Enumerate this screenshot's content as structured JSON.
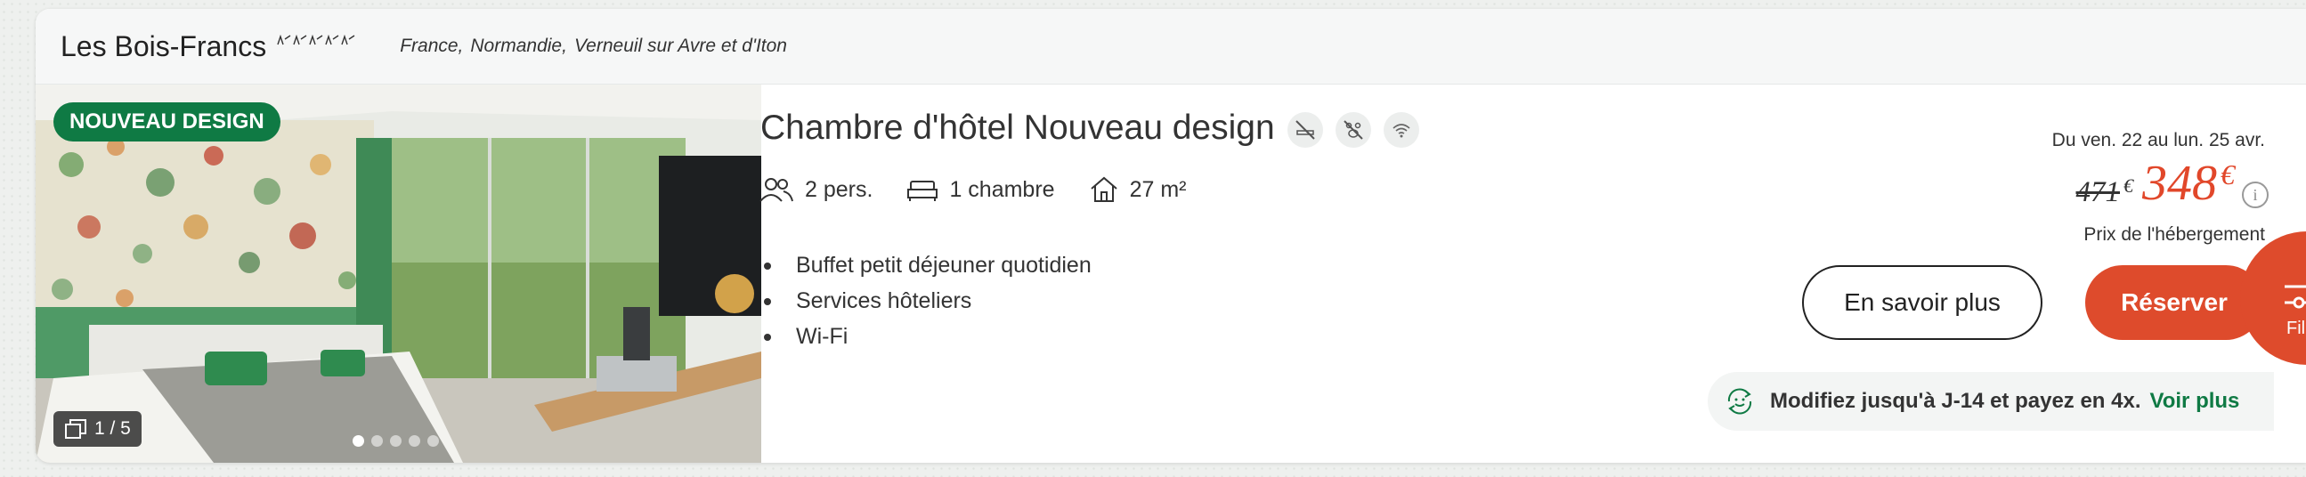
{
  "hotel": {
    "name": "Les Bois-Francs",
    "star_count": 5,
    "location": [
      "France",
      "Normandie",
      "Verneuil sur Avre et d'Iton"
    ],
    "location_separator": ","
  },
  "photo": {
    "badge": "NOUVEAU DESIGN",
    "counter": "1 / 5",
    "current_index": 1,
    "total": 5
  },
  "room": {
    "title": "Chambre d'hôtel Nouveau design",
    "amenity_icons": [
      "no-smoking-icon",
      "no-pets-icon",
      "wifi-icon"
    ],
    "specs": {
      "persons": "2 pers.",
      "bedrooms": "1 chambre",
      "surface": "27 m²"
    },
    "features": [
      "Buffet petit déjeuner quotidien",
      "Services hôteliers",
      "Wi-Fi"
    ]
  },
  "pricing": {
    "dates": "Du ven. 22 au lun. 25 avr.",
    "old_price": "471",
    "old_currency": "€",
    "new_price": "348",
    "new_currency": "€",
    "note": "Prix de l'hébergement"
  },
  "actions": {
    "more_label": "En savoir plus",
    "book_label": "Réserver"
  },
  "modify_banner": {
    "text": "Modifiez jusqu'à J-14 et payez en 4x.",
    "link": "Voir plus"
  },
  "filter_fab": {
    "label": "Fil"
  },
  "colors": {
    "brand_green": "#0f7a44",
    "accent_red": "#de4b2c",
    "price_red": "#e1472a"
  }
}
